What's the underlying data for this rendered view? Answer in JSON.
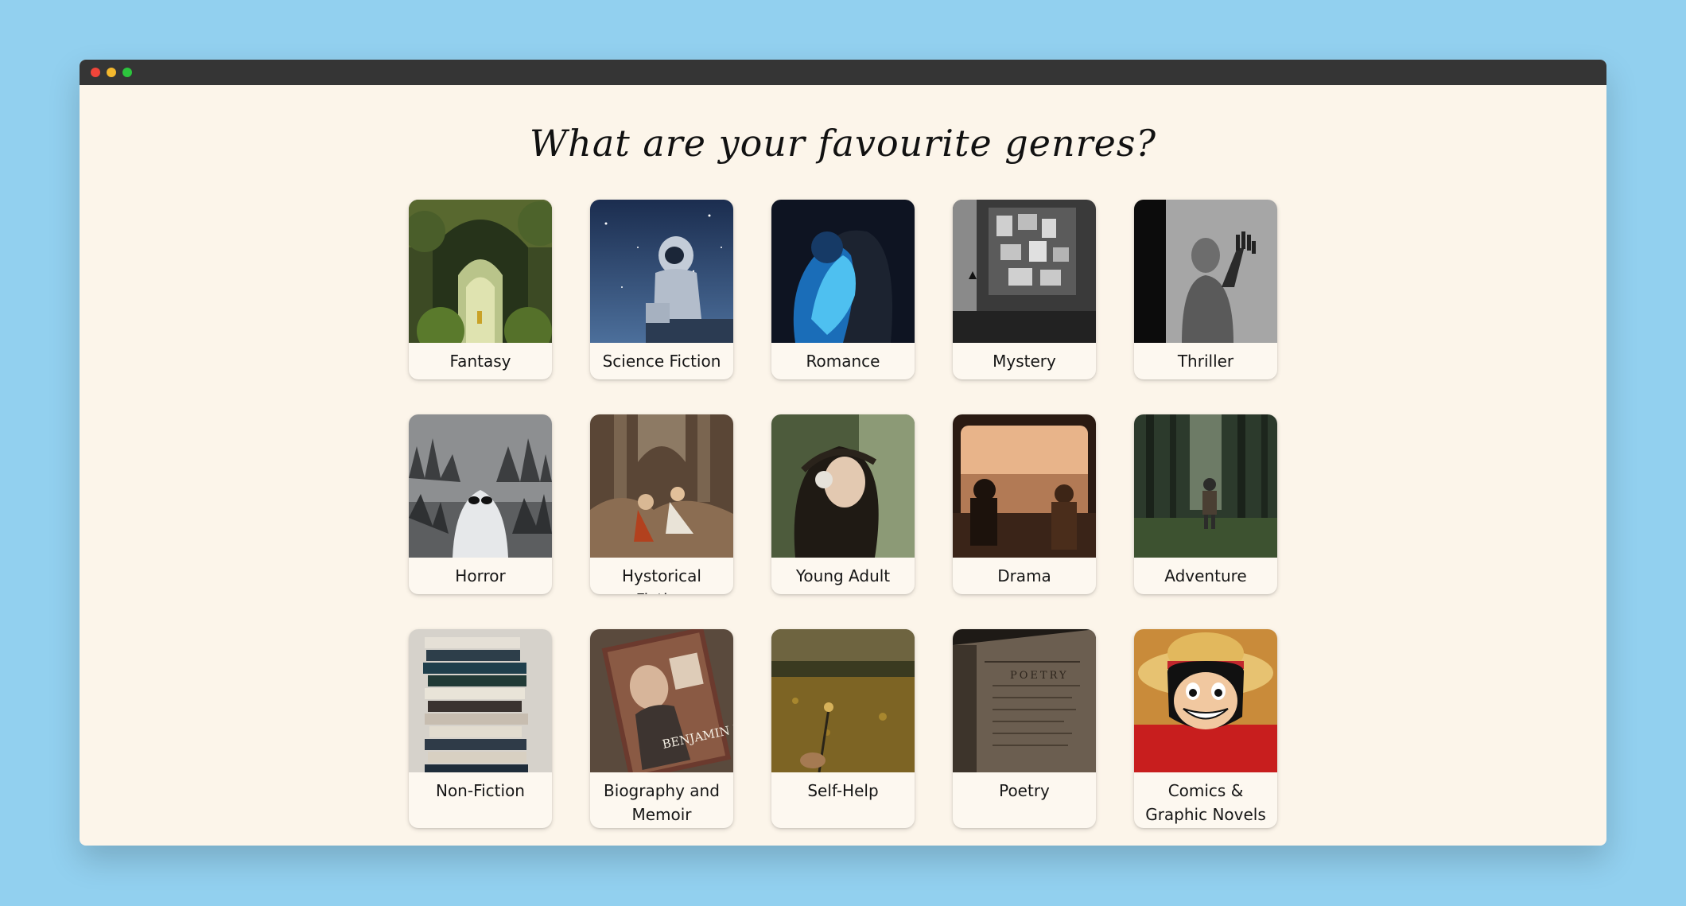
{
  "page": {
    "title": "What are your favourite genres?"
  },
  "colors": {
    "desktop_bg": "#92d0ef",
    "window_bg": "#fcf5ea",
    "titlebar_bg": "#353535",
    "traffic_red": "#f0453a",
    "traffic_yellow": "#f3b82e",
    "traffic_green": "#2cc53d"
  },
  "genres": [
    {
      "label": "Fantasy",
      "icon": "fantasy-image"
    },
    {
      "label": "Science Fiction",
      "icon": "science-fiction-image"
    },
    {
      "label": "Romance",
      "icon": "romance-image"
    },
    {
      "label": "Mystery",
      "icon": "mystery-image"
    },
    {
      "label": "Thriller",
      "icon": "thriller-image"
    },
    {
      "label": "Horror",
      "icon": "horror-image"
    },
    {
      "label": "Hystorical Fiction",
      "icon": "historical-fiction-image"
    },
    {
      "label": "Young Adult",
      "icon": "young-adult-image"
    },
    {
      "label": "Drama",
      "icon": "drama-image"
    },
    {
      "label": "Adventure",
      "icon": "adventure-image"
    },
    {
      "label": "Non-Fiction",
      "icon": "non-fiction-image"
    },
    {
      "label": "Biography and Memoir",
      "icon": "biography-image",
      "image_text": "BENJAMIN FRANKLIN"
    },
    {
      "label": "Self-Help",
      "icon": "self-help-image"
    },
    {
      "label": "Poetry",
      "icon": "poetry-image",
      "image_text": "POETRY"
    },
    {
      "label": "Comics & Graphic Novels",
      "icon": "comics-image"
    }
  ]
}
